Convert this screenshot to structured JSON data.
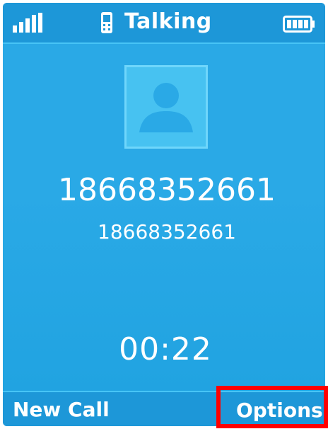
{
  "status_bar": {
    "title": "Talking",
    "signal_icon": "signal-strength-icon",
    "phone_icon": "handset-icon",
    "battery_icon": "battery-full-icon"
  },
  "call": {
    "avatar_icon": "contact-avatar-icon",
    "name": "18668352661",
    "number": "18668352661",
    "duration": "00:22"
  },
  "softkeys": {
    "left_label": "New Call",
    "right_label": "Options"
  },
  "colors": {
    "background": "#2aa9e6",
    "bar": "#1d97d8",
    "text": "#ffffff",
    "highlight": "#ff0000"
  }
}
